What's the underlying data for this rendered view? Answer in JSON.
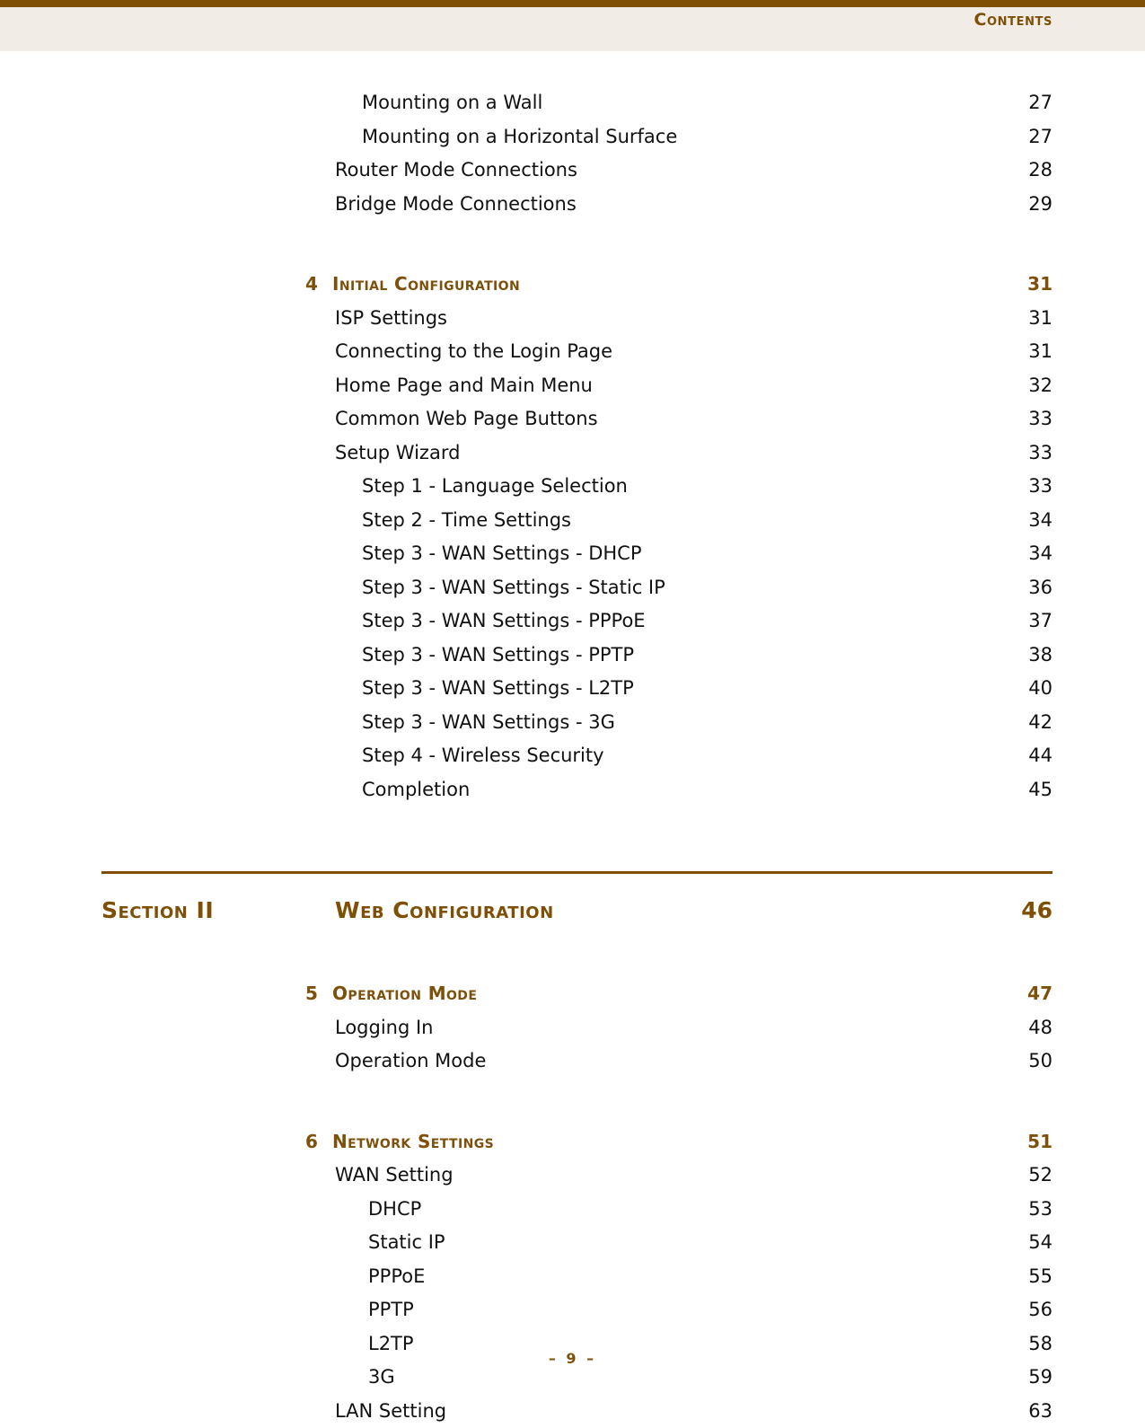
{
  "header": {
    "title": "Contents"
  },
  "footer": {
    "page_marker": "–  9  –"
  },
  "colors": {
    "brown_rule": "#7E4F04",
    "brown_heading": "#7E5009",
    "header_background": "#F1EDE6",
    "body_text": "#111111",
    "page_background": "#FFFFFF"
  },
  "toc": {
    "top_entries": [
      {
        "label": "Mounting on a Wall",
        "page": "27",
        "level": 2
      },
      {
        "label": "Mounting on a Horizontal Surface",
        "page": "27",
        "level": 2
      },
      {
        "label": "Router Mode Connections",
        "page": "28",
        "level": 1
      },
      {
        "label": "Bridge Mode Connections",
        "page": "29",
        "level": 1
      }
    ],
    "chapter_4": {
      "number": "4",
      "title": "Initial Configuration",
      "page": "31",
      "entries": [
        {
          "label": "ISP Settings",
          "page": "31",
          "level": 1
        },
        {
          "label": "Connecting to the Login Page",
          "page": "31",
          "level": 1
        },
        {
          "label": "Home Page and Main Menu",
          "page": "32",
          "level": 1
        },
        {
          "label": "Common Web Page Buttons",
          "page": "33",
          "level": 1
        },
        {
          "label": "Setup Wizard",
          "page": "33",
          "level": 1
        },
        {
          "label": "Step 1 - Language Selection",
          "page": "33",
          "level": 2
        },
        {
          "label": "Step 2 - Time Settings",
          "page": "34",
          "level": 2
        },
        {
          "label": "Step 3 - WAN Settings - DHCP",
          "page": "34",
          "level": 2
        },
        {
          "label": "Step 3 - WAN Settings - Static IP",
          "page": "36",
          "level": 2
        },
        {
          "label": "Step 3 - WAN Settings - PPPoE",
          "page": "37",
          "level": 2
        },
        {
          "label": "Step 3 - WAN Settings - PPTP",
          "page": "38",
          "level": 2
        },
        {
          "label": "Step 3 - WAN Settings - L2TP",
          "page": "40",
          "level": 2
        },
        {
          "label": "Step 3 - WAN Settings - 3G",
          "page": "42",
          "level": 2
        },
        {
          "label": "Step 4 - Wireless Security",
          "page": "44",
          "level": 2
        },
        {
          "label": "Completion",
          "page": "45",
          "level": 2
        }
      ]
    },
    "section_2": {
      "label": "Section II",
      "title": "Web Configuration",
      "page": "46"
    },
    "chapter_5": {
      "number": "5",
      "title": "Operation Mode",
      "page": "47",
      "entries": [
        {
          "label": "Logging In",
          "page": "48",
          "level": 1
        },
        {
          "label": "Operation Mode",
          "page": "50",
          "level": 1
        }
      ]
    },
    "chapter_6": {
      "number": "6",
      "title": "Network Settings",
      "page": "51",
      "entries": [
        {
          "label": "WAN Setting",
          "page": "52",
          "level": 1
        },
        {
          "label": "DHCP",
          "page": "53",
          "level": 3
        },
        {
          "label": "Static IP",
          "page": "54",
          "level": 3
        },
        {
          "label": "PPPoE",
          "page": "55",
          "level": 3
        },
        {
          "label": "PPTP",
          "page": "56",
          "level": 3
        },
        {
          "label": "L2TP",
          "page": "58",
          "level": 3
        },
        {
          "label": "3G",
          "page": "59",
          "level": 3
        },
        {
          "label": "LAN Setting",
          "page": "63",
          "level": 1
        }
      ]
    }
  }
}
